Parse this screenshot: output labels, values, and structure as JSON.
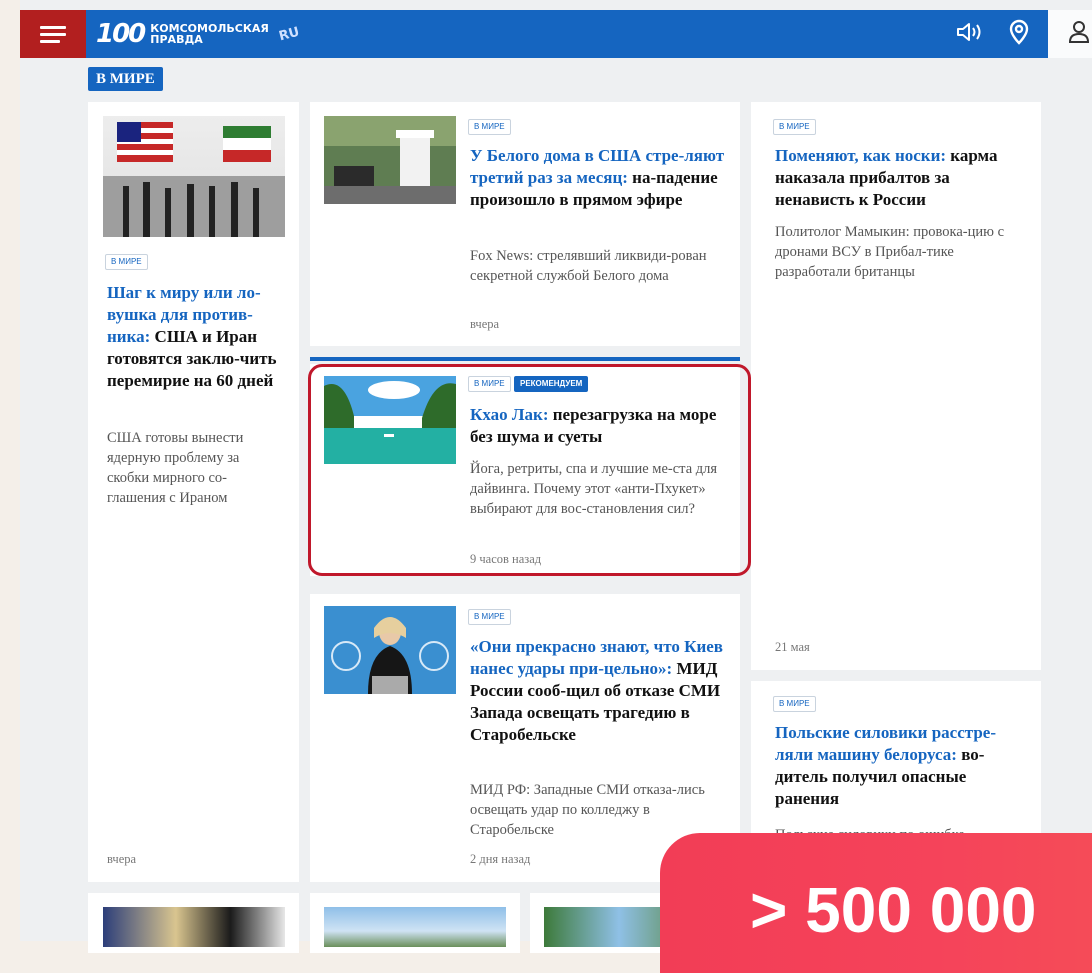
{
  "header": {
    "logo_number": "100",
    "logo_line1": "Комсомольская",
    "logo_line2": "правда",
    "logo_mark": "RU",
    "icons": [
      "menu-icon",
      "sound-icon",
      "location-pin-icon",
      "user-icon"
    ],
    "brand_color": "#1565c0",
    "menu_color": "#b21f1f"
  },
  "section": {
    "label": "В МИРЕ"
  },
  "rubric_label": "В МИРЕ",
  "recommend_label": "РЕКОМЕНДУЕМ",
  "left_article": {
    "title_highlight": "Шаг к миру или ло-вушка для против-ника:",
    "title_rest": "США и Иран готовятся заклю-чить перемирие на 60 дней",
    "lead": "США готовы вынести ядерную проблему за скобки мирного со-глашения с Ираном",
    "time": "вчера"
  },
  "middle_articles": [
    {
      "title_highlight": "У Белого дома в США стре-ляют третий раз за месяц:",
      "title_rest": "на-падение произошло в прямом эфире",
      "lead": "Fox News: стрелявший ликвиди-рован секретной службой Белого дома",
      "time": "вчера"
    },
    {
      "title_highlight": "Кхао Лак:",
      "title_rest": "перезагрузка на море без шума и суеты",
      "lead": "Йога, ретриты, спа и лучшие ме-ста для дайвинга. Почему этот «анти-Пхукет» выбирают для вос-становления сил?",
      "time": "9 часов назад"
    },
    {
      "title_highlight": "«Они прекрасно знают, что Киев нанес удары при-цельно»:",
      "title_rest": "МИД России сооб-щил об отказе СМИ Запада освещать трагедию в Старобельске",
      "lead": "МИД РФ: Западные СМИ отказа-лись освещать удар по колледжу в Старобельске",
      "time": "2 дня назад"
    }
  ],
  "right_articles": [
    {
      "title_highlight": "Поменяют, как носки:",
      "title_rest": "карма наказала прибалтов за ненависть к России",
      "lead": "Политолог Мамыкин: провока-цию с дронами ВСУ в Прибал-тике разработали британцы",
      "time": "21 мая"
    },
    {
      "title_highlight": "Польские силовики расстре-ляли машину белоруса:",
      "title_rest": "во-дитель получил опасные ранения",
      "lead": "Польские силовики по ошибке"
    }
  ],
  "promo": {
    "text": "> 500 000"
  }
}
